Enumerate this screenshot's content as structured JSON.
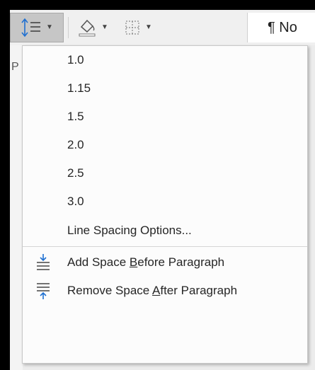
{
  "toolbar": {
    "line_spacing_icon": "line-spacing-icon",
    "shading_icon": "paint-bucket-icon",
    "borders_icon": "borders-icon",
    "style_label": "¶ No"
  },
  "doc_fragment": "P",
  "menu": {
    "options": [
      "1.0",
      "1.15",
      "1.5",
      "2.0",
      "2.5",
      "3.0"
    ],
    "line_spacing_options": "Line Spacing Options...",
    "add_before": {
      "pre": "Add Space ",
      "key": "B",
      "post": "efore Paragraph"
    },
    "remove_after": {
      "pre": "Remove Space ",
      "key": "A",
      "post": "fter Paragraph"
    }
  },
  "colors": {
    "accent_blue": "#1e6fd1",
    "active_button": "#c6c6c6"
  }
}
